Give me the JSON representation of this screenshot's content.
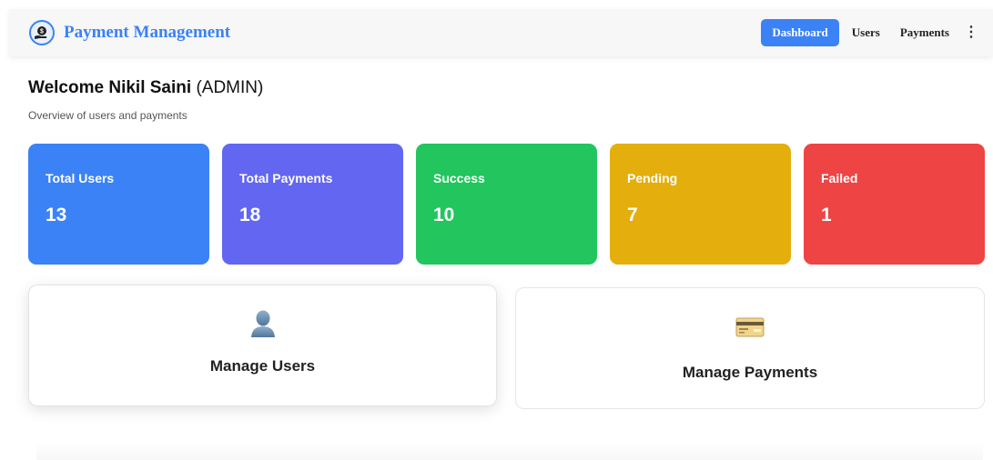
{
  "header": {
    "title": "Payment Management",
    "nav": [
      {
        "label": "Dashboard",
        "active": true
      },
      {
        "label": "Users",
        "active": false
      },
      {
        "label": "Payments",
        "active": false
      }
    ],
    "more_icon": "⋮"
  },
  "welcome": {
    "name": "Welcome Nikil Saini",
    "role": "(ADMIN)",
    "subtitle": "Overview of users and payments"
  },
  "stats": [
    {
      "label": "Total Users",
      "value": "13",
      "color": "#3b82f6"
    },
    {
      "label": "Total Payments",
      "value": "18",
      "color": "#6366f1"
    },
    {
      "label": "Success",
      "value": "10",
      "color": "#22c55e"
    },
    {
      "label": "Pending",
      "value": "7",
      "color": "#e4ae0c"
    },
    {
      "label": "Failed",
      "value": "1",
      "color": "#ef4444"
    }
  ],
  "cards": {
    "users": {
      "title": "Manage Users",
      "icon": "user-icon"
    },
    "payments": {
      "title": "Manage Payments",
      "icon": "credit-card-icon"
    }
  },
  "colors": {
    "accent": "#3b82f6"
  }
}
